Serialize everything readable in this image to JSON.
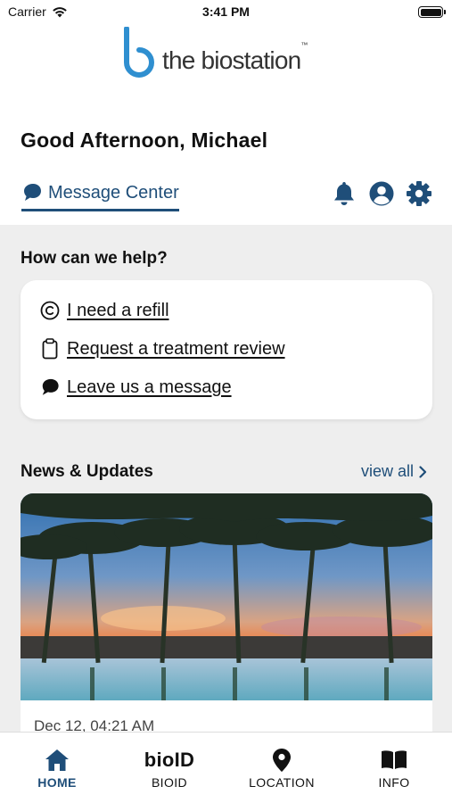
{
  "status_bar": {
    "carrier": "Carrier",
    "time": "3:41 PM"
  },
  "brand": {
    "name": "the biostation",
    "tm": "™"
  },
  "greeting": "Good Afternoon, Michael",
  "message_center": {
    "label": "Message Center"
  },
  "help": {
    "title": "How can we help?",
    "items": [
      {
        "label": "I need a refill",
        "icon": "refill-icon"
      },
      {
        "label": "Request a treatment review",
        "icon": "clipboard-icon"
      },
      {
        "label": "Leave us a message",
        "icon": "chat-bubble-icon"
      }
    ]
  },
  "news": {
    "title": "News & Updates",
    "view_all": "view all",
    "items": [
      {
        "date": "Dec 12, 04:21 AM"
      }
    ]
  },
  "tabs": [
    {
      "label": "HOME",
      "icon": "home-icon",
      "active": true
    },
    {
      "label": "BIOID",
      "icon_text": "bioID",
      "active": false
    },
    {
      "label": "LOCATION",
      "icon": "location-pin-icon",
      "active": false
    },
    {
      "label": "INFO",
      "icon": "book-icon",
      "active": false
    }
  ],
  "colors": {
    "brand_blue": "#1f4e79",
    "logo_blue": "#2f8fd0",
    "content_bg": "#eeeeee"
  }
}
